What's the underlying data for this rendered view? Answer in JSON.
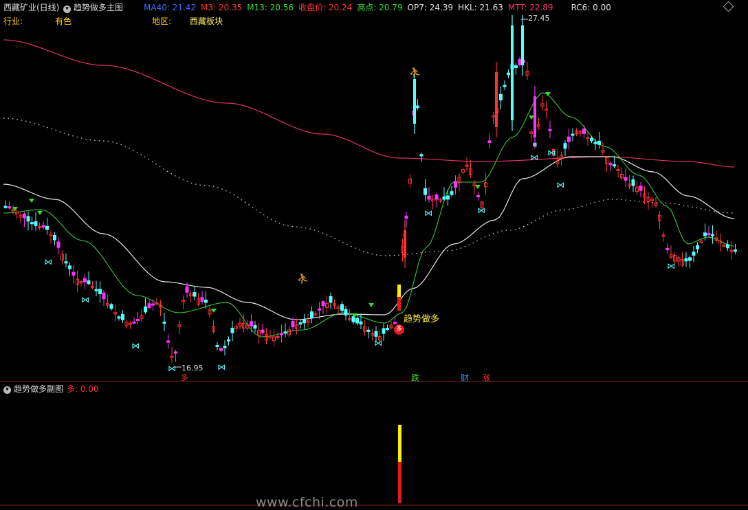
{
  "header": {
    "stock_name": "西藏矿业(日线)",
    "main_chart_name": "趋势做多主图",
    "indicators": [
      {
        "label": "MA40: 21.42",
        "color": "#3a6cff"
      },
      {
        "label": "M3: 20.35",
        "color": "#ff3333"
      },
      {
        "label": "M13: 20.56",
        "color": "#33dd33"
      },
      {
        "label": "收盘价: 20.24",
        "color": "#ff3333"
      },
      {
        "label": "高点: 20.79",
        "color": "#33dd33"
      },
      {
        "label": "OP7: 24.39",
        "color": "#e0e0e0"
      },
      {
        "label": "HKL: 21.63",
        "color": "#e0e0e0"
      },
      {
        "label": "MTT: 22.89",
        "color": "#ff3366"
      },
      {
        "label": "RC6: 0.00",
        "color": "#e0e0e0"
      }
    ]
  },
  "info_row": {
    "industry_label": "行业:",
    "industry_value": "有色",
    "region_label": "地区:",
    "region_value": "西藏板块"
  },
  "annotations": {
    "high_label": "27.45",
    "low_label": "16.95",
    "signal_text": "趋势做多",
    "signal_badge": "多",
    "buy_marker": "多",
    "bottom_markers": [
      {
        "text": "跌",
        "color": "#33dd33"
      },
      {
        "text": "财",
        "color": "#3a8cff"
      },
      {
        "text": "涨",
        "color": "#ff3333"
      }
    ]
  },
  "sub_chart": {
    "title": "趋势做多副图",
    "value_label": "多: 0.00",
    "bar_values": {
      "red": 0.0,
      "yellow": 0.0
    }
  },
  "watermark": "www.cfchi.com",
  "colors": {
    "up": "#ff3333",
    "down_cyan": "#54ffff",
    "down_magenta": "#ff33ff",
    "ma_white": "#e8e8e8",
    "ma_green": "#33cc33",
    "ma_pink": "#e0306a",
    "grid": "#8b1a1a"
  },
  "chart_data": {
    "type": "candlestick",
    "y_high": 27.45,
    "y_low": 16.95,
    "close_last": 20.24,
    "ma40_last": 21.42,
    "m13_last": 20.56
  }
}
